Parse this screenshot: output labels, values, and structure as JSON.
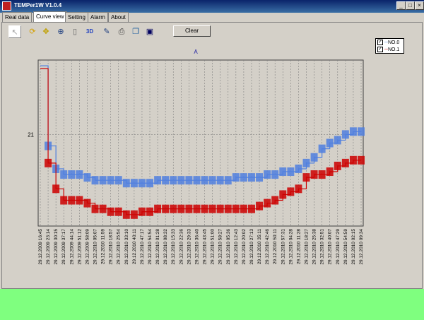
{
  "window": {
    "title": "TEMPer1W V1.0.4",
    "controls": [
      "_",
      "□",
      "×"
    ]
  },
  "tabs": [
    {
      "label": "Real data",
      "active": false
    },
    {
      "label": "Curve view",
      "active": true
    },
    {
      "label": "Setting",
      "active": false
    },
    {
      "label": "Alarm",
      "active": false
    },
    {
      "label": "About",
      "active": false
    }
  ],
  "toolbar": {
    "tools": [
      "select-arrow-icon",
      "refresh-icon",
      "pan-icon",
      "zoom-icon",
      "page-icon",
      "3d-icon",
      "edit-icon",
      "print-icon",
      "copy-icon",
      "save-icon"
    ],
    "three_d_label": "3D",
    "clear_label": "Clear"
  },
  "legend": {
    "items": [
      {
        "label": "NO.0",
        "checked": true
      },
      {
        "label": "NO.1",
        "checked": true
      }
    ]
  },
  "chart_data": {
    "type": "line",
    "title": "A",
    "y_tick_labels": [
      "21"
    ],
    "x_tick_labels": [
      "29.12.2009 16:45",
      "29.12.2009 23:14",
      "29.12.2009 30:15",
      "29.12.2009 37:17",
      "29.12.2009 44:14",
      "29.12.2009 51:12",
      "29.12.2009 58:09",
      "29.12.2010 05:07",
      "29.12.2010 11:59",
      "29.12.2010 18:57",
      "29.12.2010 25:54",
      "29.12.2010 33:10",
      "29.12.2010 40:11",
      "29.12.2010 47:17",
      "29.12.2010 54:54",
      "29.12.2010 01:28",
      "29.12.2010 08:32",
      "29.12.2010 15:33",
      "29.12.2010 22:36",
      "29.12.2010 29:33",
      "29.12.2010 36:40",
      "29.12.2010 43:45",
      "29.12.2010 51:00",
      "29.12.2010 58:27",
      "29.12.2010 05:36",
      "29.12.2010 12:43",
      "29.12.2010 20:02",
      "29.12.2010 27:13",
      "29.12.2010 35:11",
      "29.12.2010 42:46",
      "29.12.2010 50:11",
      "29.12.2010 57:31",
      "29.12.2010 04:28",
      "29.12.2010 11:28",
      "29.12.2010 18:27",
      "29.12.2010 25:38",
      "29.12.2010 32:51",
      "29.12.2010 40:07",
      "29.12.2010 47:29",
      "29.12.2010 54:59",
      "29.12.2010 02:15",
      "29.12.2010 09:34"
    ],
    "series": [
      {
        "name": "NO.0",
        "color": "#4f7fdf",
        "values": [
          23.4,
          20.6,
          19.8,
          19.6,
          19.6,
          19.6,
          19.5,
          19.4,
          19.4,
          19.4,
          19.4,
          19.3,
          19.3,
          19.3,
          19.3,
          19.4,
          19.4,
          19.4,
          19.4,
          19.4,
          19.4,
          19.4,
          19.4,
          19.4,
          19.4,
          19.5,
          19.5,
          19.5,
          19.5,
          19.6,
          19.6,
          19.7,
          19.7,
          19.8,
          20.0,
          20.2,
          20.5,
          20.7,
          20.8,
          21.0,
          21.1,
          21.1
        ]
      },
      {
        "name": "NO.1",
        "color": "#cc0000",
        "values": [
          23.3,
          20.0,
          19.1,
          18.7,
          18.7,
          18.7,
          18.6,
          18.4,
          18.4,
          18.3,
          18.3,
          18.2,
          18.2,
          18.3,
          18.3,
          18.4,
          18.4,
          18.4,
          18.4,
          18.4,
          18.4,
          18.4,
          18.4,
          18.4,
          18.4,
          18.4,
          18.4,
          18.4,
          18.5,
          18.6,
          18.7,
          18.9,
          19.0,
          19.1,
          19.5,
          19.6,
          19.6,
          19.7,
          19.9,
          20.0,
          20.1,
          20.1
        ]
      }
    ],
    "grid": true,
    "legend_position": "top-right"
  }
}
